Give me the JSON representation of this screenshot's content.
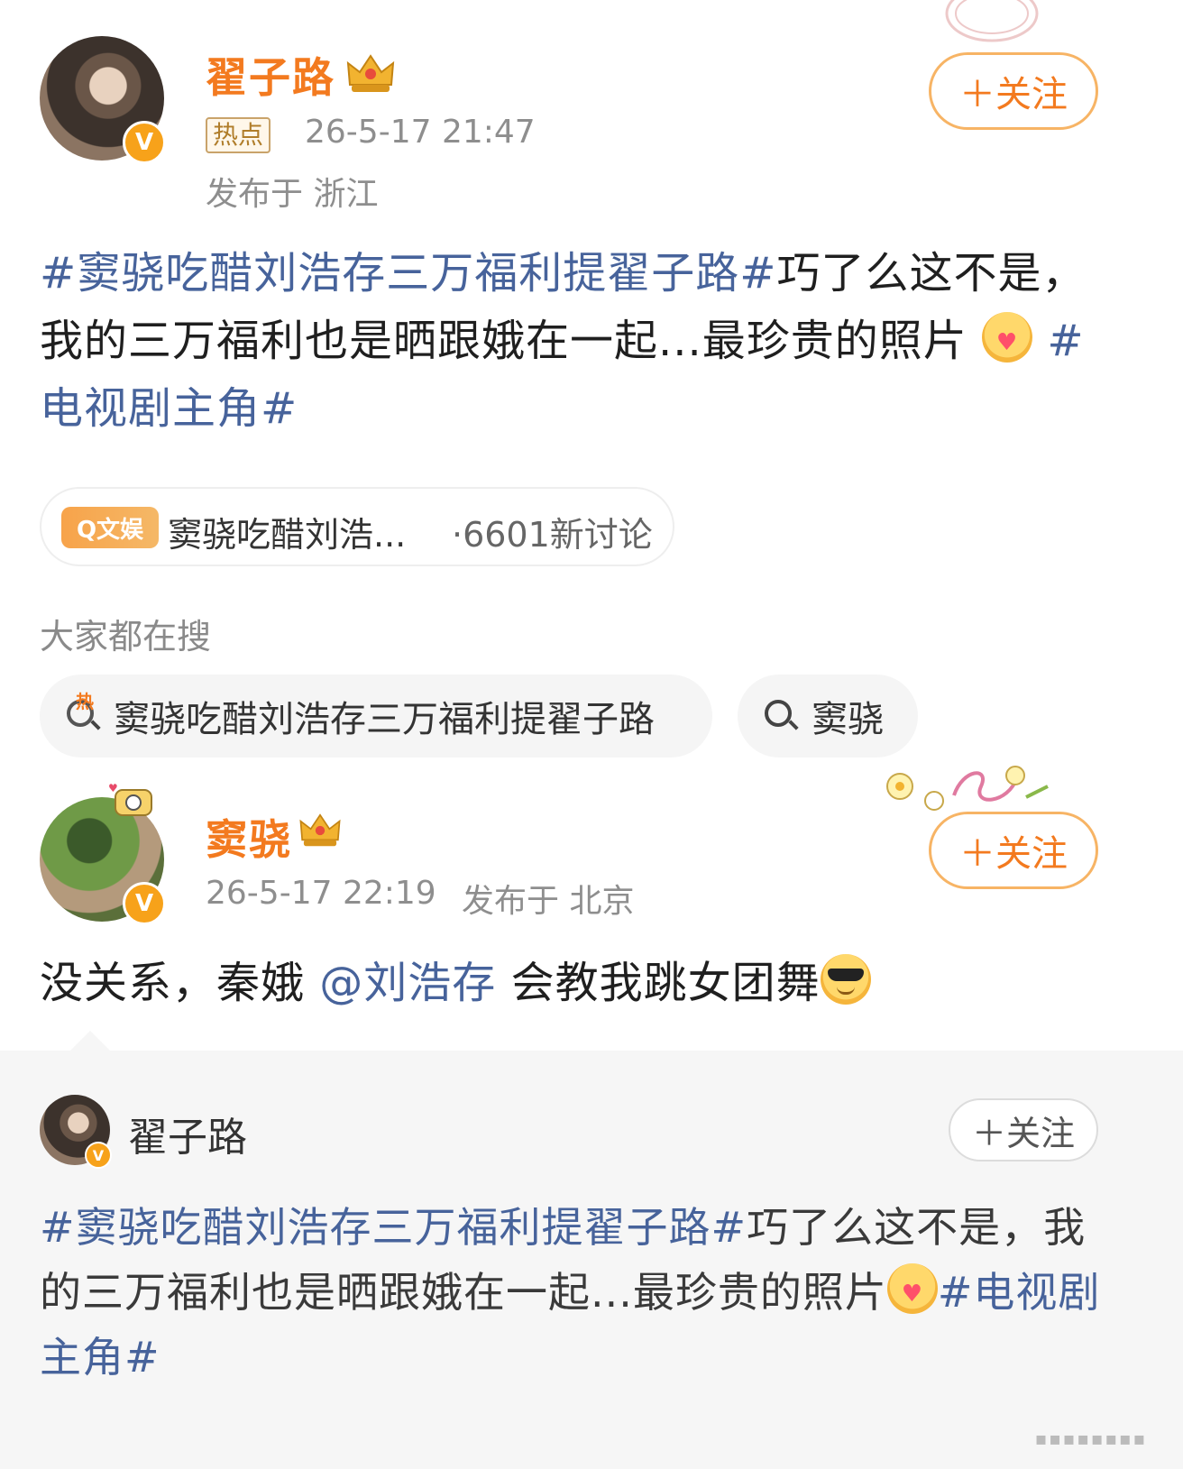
{
  "post1": {
    "author": "翟子路",
    "hot_tag": "热点",
    "timestamp": "26-5-17 21:47",
    "location": "发布于 浙江",
    "follow_label": "＋关注",
    "topic_prefix": "#窦骁吃醋刘浩存三万福利提翟子路#",
    "text_main": "巧了么这不是，我的三万福利也是晒跟娥在一起...最珍贵的照片",
    "topic_suffix": "#电视剧主角#"
  },
  "topic_card": {
    "badge": "Q文娱",
    "title": "窦骁吃醋刘浩...",
    "count": "·6601新讨论"
  },
  "search_section": {
    "label": "大家都在搜",
    "items": [
      {
        "label": "窦骁吃醋刘浩存三万福利提翟子路",
        "icon": "hot-search-icon",
        "hot_mark": "热"
      },
      {
        "label": "窦骁",
        "icon": "search-icon"
      }
    ]
  },
  "post2": {
    "author": "窦骁",
    "timestamp": "26-5-17 22:19",
    "location": "发布于 北京",
    "follow_label": "＋关注",
    "text_before": "没关系，秦娥",
    "mention": "@刘浩存",
    "text_after": "会教我跳女团舞"
  },
  "repost": {
    "author": "翟子路",
    "follow_label": "＋关注",
    "topic_prefix": "#窦骁吃醋刘浩存三万福利提翟子路#",
    "text_main": "巧了么这不是，我的三万福利也是晒跟娥在一起...最珍贵的照片",
    "topic_suffix": "#电视剧主角#"
  },
  "colors": {
    "accent": "#f37a1f",
    "topic": "#47639b",
    "meta": "#8e8e8e"
  }
}
